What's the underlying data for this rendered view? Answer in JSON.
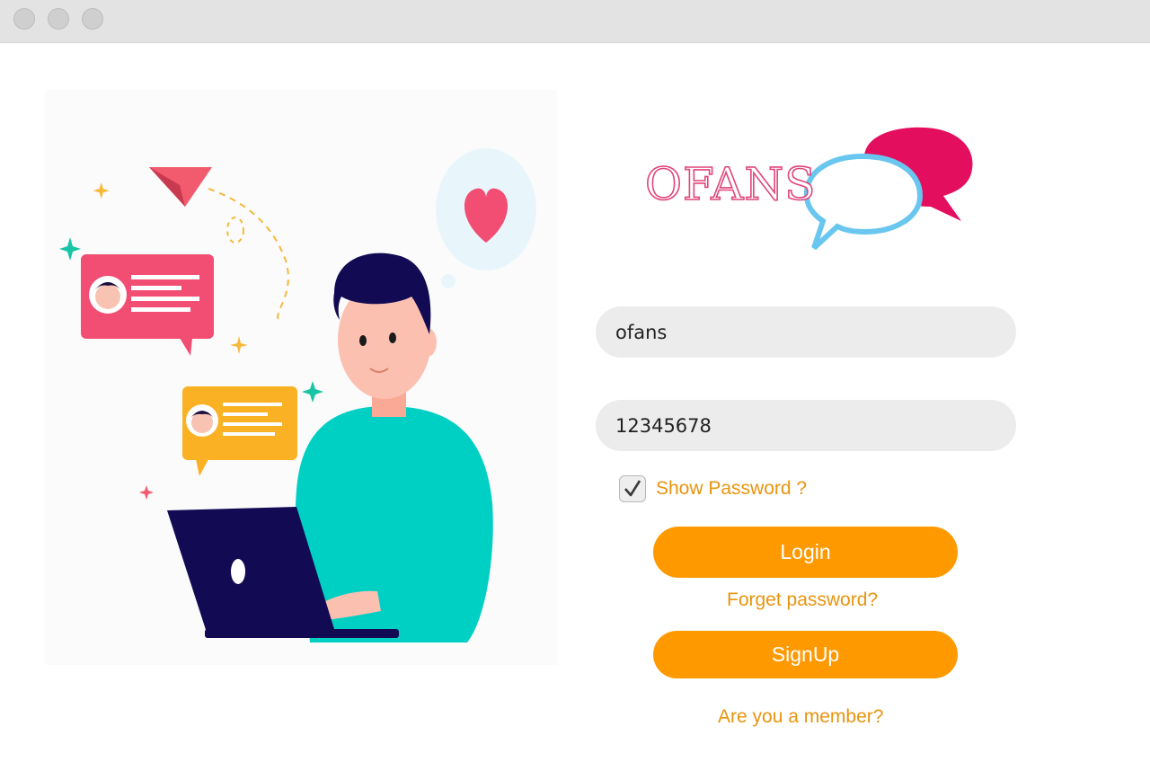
{
  "window": {
    "controls": [
      "close",
      "minimize",
      "zoom"
    ]
  },
  "logo": {
    "text": "OFANS",
    "colors": {
      "text": "#e0457b",
      "bubble_back": "#e40e5e",
      "bubble_front": "#69c6ef"
    }
  },
  "illustration": {
    "icon": "person-laptop-chat-illustration"
  },
  "form": {
    "username_value": "ofans",
    "password_value": "12345678",
    "show_password_label": "Show Password ?",
    "show_password_checked": true,
    "login_label": "Login",
    "forget_password_label": "Forget password?",
    "signup_label": "SignUp",
    "member_label": "Are you a member?"
  },
  "colors": {
    "accent": "#ff9900",
    "link": "#e8940e",
    "field_bg": "#ececec"
  }
}
